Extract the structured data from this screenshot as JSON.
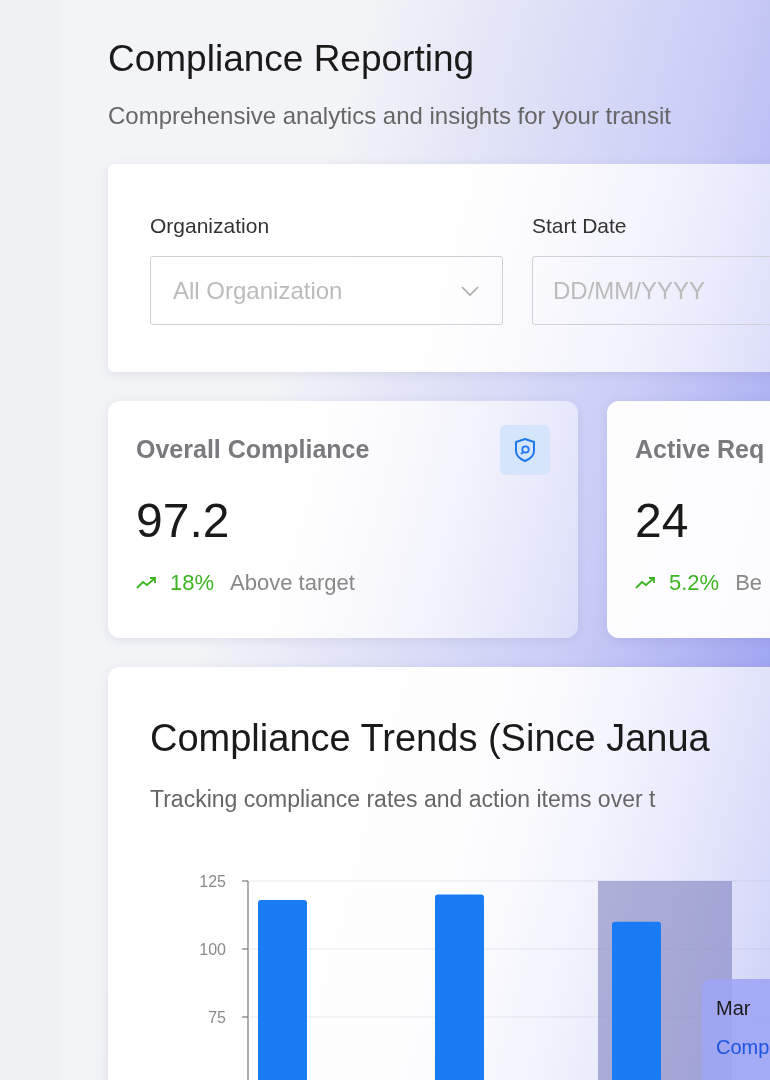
{
  "header": {
    "title": "Compliance Reporting",
    "subtitle": "Comprehensive analytics and insights for your transit"
  },
  "filters": [
    {
      "label": "Organization",
      "kind": "select",
      "placeholder": "All Organization"
    },
    {
      "label": "Start Date",
      "kind": "date",
      "placeholder": "DD/MM/YYYY"
    }
  ],
  "stats": [
    {
      "title": "Overall Compliance",
      "value": "97.2",
      "change": "18%",
      "note": "Above target",
      "icon": true
    },
    {
      "title": "Active Req",
      "value": "24",
      "change": "5.2%",
      "note": "Be"
    }
  ],
  "trends": {
    "title": "Compliance Trends (Since Janua",
    "subtitle": "Tracking compliance rates and action items over t",
    "chart_data": {
      "type": "bar",
      "ylim": [
        50,
        125
      ],
      "yticks": [
        75,
        100,
        125
      ],
      "series": [
        {
          "color": "#1a7cf5",
          "values": [
            118,
            120,
            110
          ]
        }
      ]
    },
    "tooltip": {
      "title": "Mar",
      "series": "Comp"
    }
  }
}
